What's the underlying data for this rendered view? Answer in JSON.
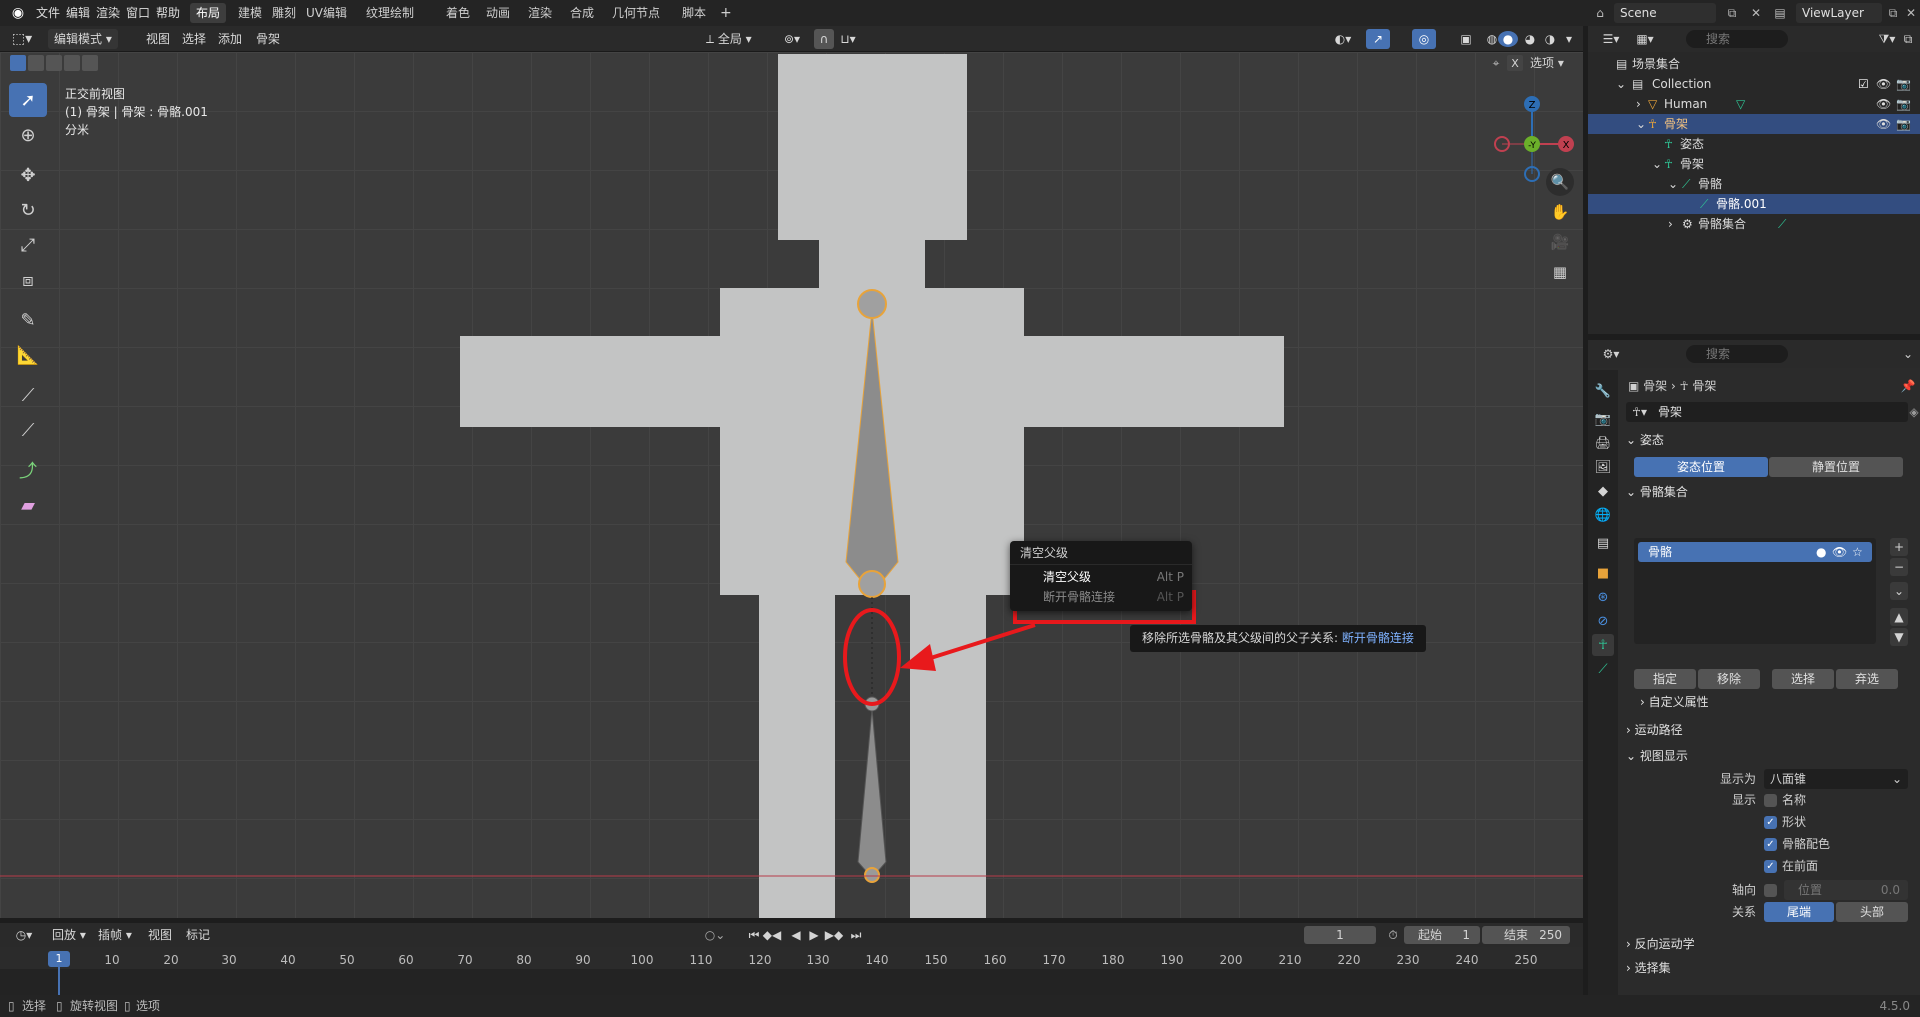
{
  "app": {
    "version": "4.5.0"
  },
  "menu": {
    "file": "文件",
    "edit": "编辑",
    "render": "渲染",
    "window": "窗口",
    "help": "帮助"
  },
  "workspaces": [
    "布局",
    "建模",
    "雕刻",
    "UV编辑",
    "纹理绘制",
    "着色",
    "动画",
    "渲染",
    "合成",
    "几何节点",
    "脚本"
  ],
  "workspace_add": "+",
  "scene": {
    "name": "Scene",
    "view_layer": "ViewLayer"
  },
  "viewport_header": {
    "mode": "编辑模式",
    "view": "视图",
    "select": "选择",
    "add": "添加",
    "armature": "骨架",
    "transform": "全局",
    "options": "选项",
    "x_label": "X"
  },
  "viewport_overlay": {
    "view_name": "正交前视图",
    "object_info": "(1) 骨架 | 骨架 : 骨骼.001",
    "units": "分米"
  },
  "gizmo": {
    "z": "Z",
    "y": "-Y",
    "x": "X"
  },
  "context_menu": {
    "title": "清空父级",
    "items": [
      {
        "label": "清空父级",
        "shortcut": "Alt P"
      },
      {
        "label": "断开骨骼连接",
        "shortcut": "Alt P"
      }
    ]
  },
  "tooltip": {
    "text": "移除所选骨骼及其父级间的父子关系: ",
    "highlight": "断开骨骼连接"
  },
  "outliner": {
    "search_placeholder": "搜索",
    "root": "场景集合",
    "rows": [
      "Collection",
      "Human",
      "骨架",
      "姿态",
      "骨架",
      "骨骼",
      "骨骼.001",
      "骨骼集合"
    ]
  },
  "properties": {
    "search_placeholder": "搜索",
    "breadcrumb": [
      "骨架",
      "骨架"
    ],
    "datablock_name": "骨架",
    "pose_panel": {
      "title": "姿态",
      "pose_position": "姿态位置",
      "rest_position": "静置位置"
    },
    "bone_collections": {
      "title": "骨骼集合",
      "item": "骨骼",
      "assign": "指定",
      "remove": "移除",
      "select": "选择",
      "deselect": "弃选"
    },
    "custom_props": "自定义属性",
    "motion_paths": "运动路径",
    "viewport_display": {
      "title": "视图显示",
      "display_as_label": "显示为",
      "display_as_value": "八面锥",
      "show_label": "显示",
      "names": "名称",
      "shapes": "形状",
      "bone_colors": "骨骼配色",
      "in_front": "在前面",
      "axes_label": "轴向",
      "axes_position_label": "位置",
      "axes_position_value": "0.0",
      "relation_label": "关系",
      "tail": "尾端",
      "head": "头部"
    },
    "inverse_kinematics": "反向运动学",
    "selection_sets": "选择集"
  },
  "timeline": {
    "playback": "回放",
    "keying": "插帧",
    "view": "视图",
    "marker": "标记",
    "current_frame": "1",
    "start_label": "起始",
    "start": "1",
    "end_label": "结束",
    "end": "250",
    "ticks": [
      "10",
      "20",
      "30",
      "40",
      "50",
      "60",
      "70",
      "80",
      "90",
      "100",
      "110",
      "120",
      "130",
      "140",
      "150",
      "160",
      "170",
      "180",
      "190",
      "200",
      "210",
      "220",
      "230",
      "240",
      "250"
    ],
    "marker_frame": "1"
  },
  "statusbar": {
    "select": "选择",
    "rotate": "旋转视图",
    "options": "选项"
  },
  "colors": {
    "accent": "#4772b3",
    "bone_outline": "#e8a33a",
    "annotation_red": "#e8191c",
    "outliner_selected": "#334d80"
  }
}
